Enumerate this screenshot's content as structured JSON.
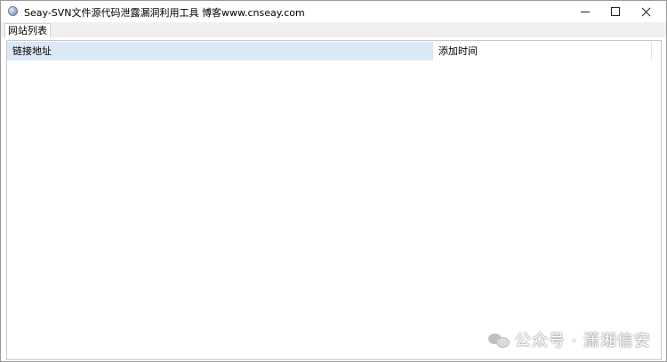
{
  "window": {
    "title": "Seay-SVN文件源代码泄露漏洞利用工具  博客www.cnseay.com",
    "icon": "globe-app-icon",
    "controls": {
      "minimize": "minimize-icon",
      "maximize": "maximize-icon",
      "close": "close-icon"
    }
  },
  "tabs": [
    {
      "label": "网站列表",
      "active": true
    }
  ],
  "table": {
    "columns": [
      {
        "label": "链接地址"
      },
      {
        "label": "添加时间"
      }
    ],
    "rows": []
  },
  "watermark": {
    "text": "公众号 · 潇湘信安",
    "icon": "wechat-icon"
  }
}
